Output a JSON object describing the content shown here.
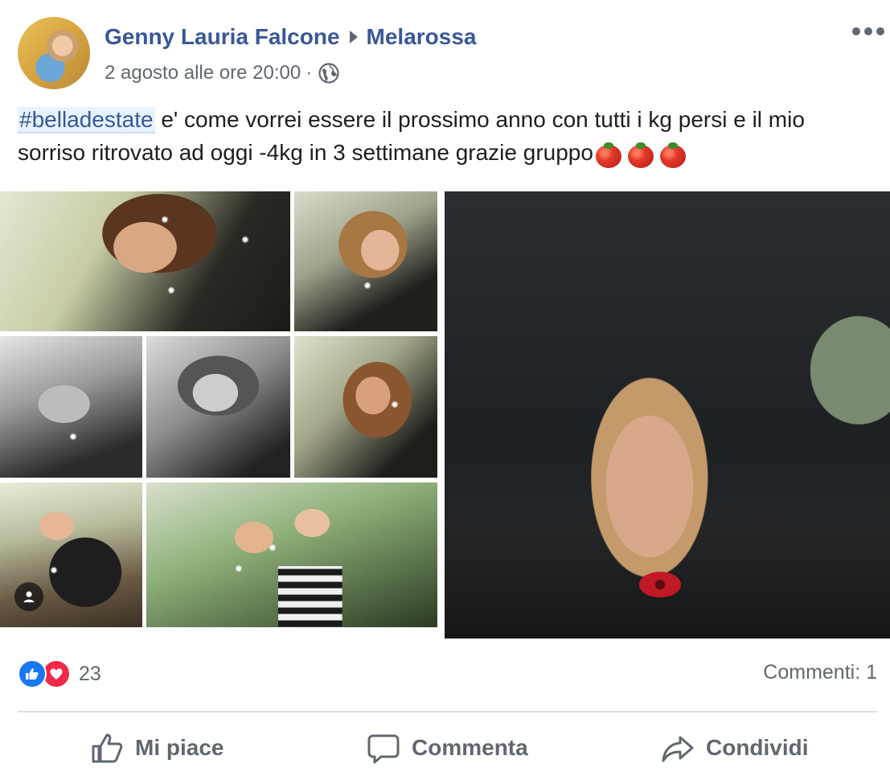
{
  "post": {
    "author": "Genny Lauria Falcone",
    "group": "Melarossa",
    "timestamp": "2 agosto alle ore 20:00",
    "separator": "·",
    "privacy_icon": "globe-icon",
    "more_icon": "ellipsis-icon",
    "hashtag": "#belladestate",
    "text": " e' come vorrei essere il prossimo anno con tutti i kg persi e il mio sorriso ritrovato ad oggi -4kg in 3 settimane grazie gruppo",
    "emoji": [
      "tomato",
      "tomato",
      "tomato"
    ]
  },
  "photos": {
    "count": 2,
    "tag_icon": "person-tag-icon"
  },
  "reactions": {
    "types": [
      "like",
      "love"
    ],
    "count": "23",
    "comments_label": "Commenti: 1"
  },
  "actions": {
    "like_label": "Mi piace",
    "comment_label": "Commenta",
    "share_label": "Condividi"
  },
  "colors": {
    "link_blue": "#385898",
    "like_blue": "#1877f2",
    "love_red": "#f0284a",
    "muted_gray": "#606770"
  }
}
